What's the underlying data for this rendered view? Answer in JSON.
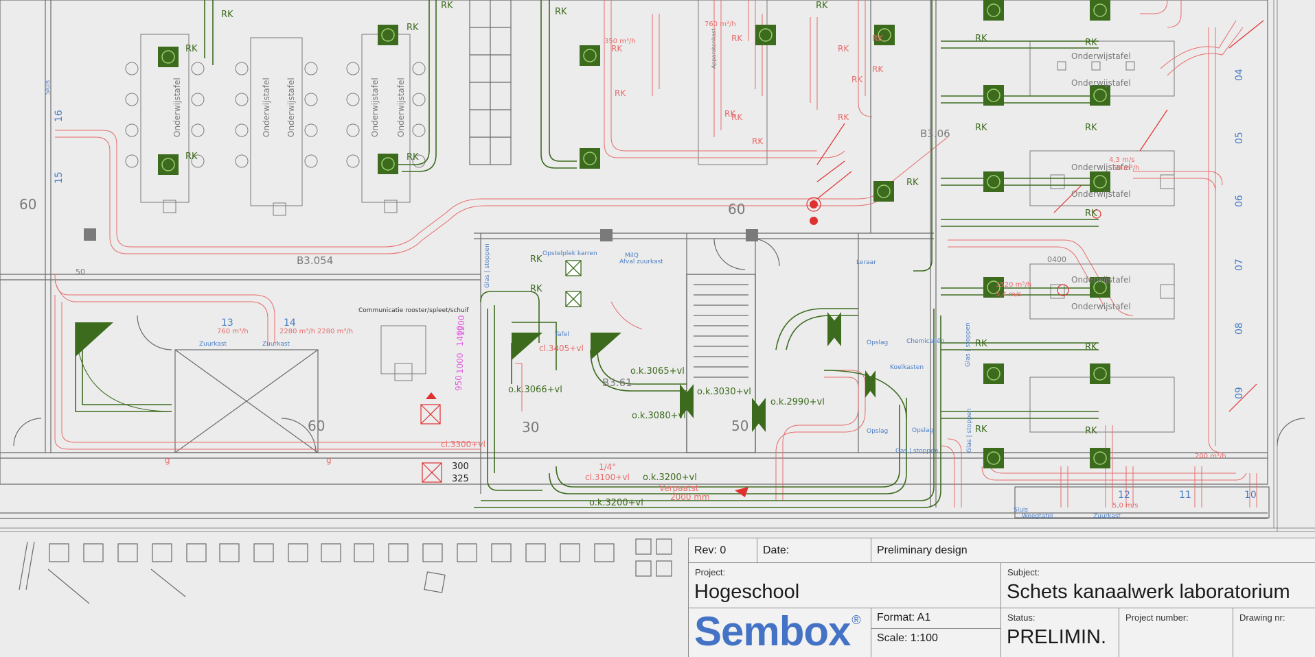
{
  "titleblock": {
    "rev_label": "Rev: 0",
    "date_label": "Date:",
    "design_phase": "Preliminary design",
    "project_label": "Project:",
    "project_value": "Hogeschool",
    "subject_label": "Subject:",
    "subject_value": "Schets kanaalwerk laboratorium",
    "logo_text": "Sembox",
    "logo_mark": "®",
    "format_label": "Format: A1",
    "scale_label": "Scale:  1:100",
    "status_label": "Status:",
    "status_value": "PRELIMIN.",
    "project_number_label": "Project number:",
    "drawing_nr_label": "Drawing nr:"
  },
  "colors": {
    "duct_supply": "#e86a6a",
    "duct_exhaust": "#3c6b1e",
    "walls": "#6a6a6a",
    "annotation_blue": "#4a7dc4",
    "annotation_magenta": "#e060e0",
    "logo": "#4472c4"
  },
  "plan": {
    "rooms": [
      "B3.054",
      "B3.06",
      "B3.61"
    ],
    "furniture_labels": [
      "Onderwijstafel",
      "Onderwijstafel",
      "Onderwijstafel",
      "Onderwijstafel",
      "Onderwijstafel",
      "Onderwijstafel",
      "Onderwijstafel",
      "Onderwijstafel",
      "Onderwijstafel",
      "Onderwijstafel",
      "Onderwijstafel"
    ],
    "rk": "RK",
    "elevations": [
      "o.k.3065+vl",
      "o.k.3030+vl",
      "o.k.3080+vl",
      "o.k.2990+vl",
      "o.k.3200+vl",
      "o.k.3200+vl",
      "o.k.3066+vl"
    ],
    "red_elevations": [
      "cl.3405+vl",
      "cl.3300+vl",
      "cl.3100+vl",
      "Verpaatst",
      "2000 mm"
    ],
    "zone_numbers": [
      "13",
      "14",
      "12",
      "11",
      "10",
      "04",
      "05",
      "06",
      "07",
      "08",
      "09",
      "16",
      "15"
    ],
    "flows": [
      "760 m³/h",
      "2280 m³/h",
      "5,0 m/s",
      "1520 m³/h",
      "5,4 m/s",
      "4,3 m/s",
      "50 m³/h",
      "200 m³/h",
      "350 m³/h"
    ],
    "blue_labels": [
      "Opstelplek karren",
      "Afval zuurkast",
      "MilQ",
      "Tafel",
      "Glas | stoppen",
      "Opslag",
      "Chemicaliën",
      "Koelkasten",
      "Opslag",
      "Opslag",
      "Gas | stoppen",
      "Leraar",
      "Weegtafel",
      "Zuurkast",
      "Zuurkast",
      "Zuurkast",
      "Sluis",
      "Sluis",
      "Glas | stoppen",
      "Glas | stoppen"
    ],
    "dim_values": [
      "300",
      "325",
      "60",
      "60",
      "60",
      "50",
      "30",
      "50",
      "0400"
    ],
    "misc": [
      "Communicatie rooster/spleet/schuif",
      "Apparatenkast",
      "g",
      "1/4\"",
      "1400",
      "1200",
      "950",
      "1000"
    ]
  }
}
